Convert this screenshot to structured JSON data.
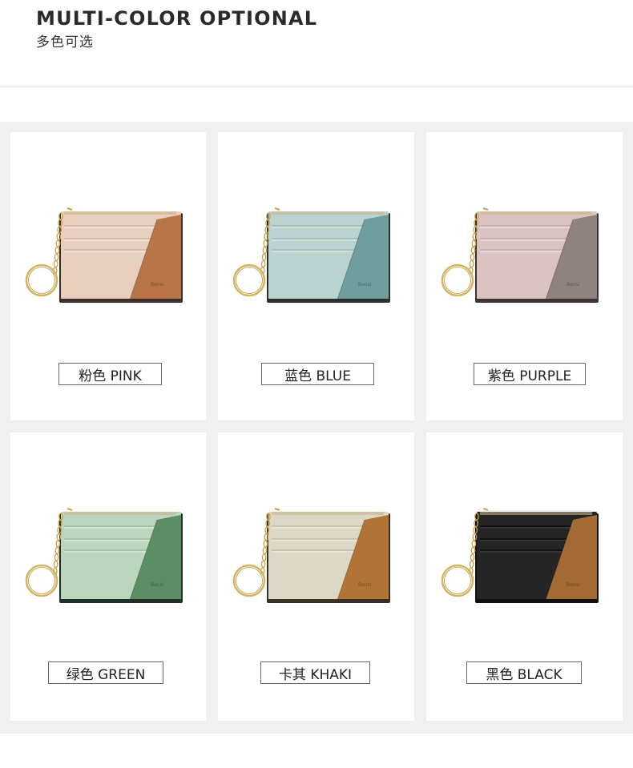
{
  "header": {
    "title": "MULTI-COLOR OPTIONAL",
    "subtitle": "多色可选"
  },
  "products": [
    {
      "label": "粉色 PINK",
      "body_color": "#e9cfbe",
      "accent_color": "#b87548",
      "edge_color": "#3a2e28",
      "brand": "Bensi"
    },
    {
      "label": "蓝色 BLUE",
      "body_color": "#b9d3d0",
      "accent_color": "#6e9f9d",
      "edge_color": "#2a2f30",
      "brand": "Bensi"
    },
    {
      "label": "紫色 PURPLE",
      "body_color": "#dcc3c1",
      "accent_color": "#8f8380",
      "edge_color": "#3a3332",
      "brand": "Bensi"
    },
    {
      "label": "绿色 GREEN",
      "body_color": "#bcd5bd",
      "accent_color": "#5b8e64",
      "edge_color": "#23302a",
      "brand": "Bensi"
    },
    {
      "label": "卡其 KHAKI",
      "body_color": "#dcd8c5",
      "accent_color": "#b27436",
      "edge_color": "#3a3026",
      "brand": "Bensi"
    },
    {
      "label": "黑色 BLACK",
      "body_color": "#252525",
      "accent_color": "#a46a34",
      "edge_color": "#111111",
      "brand": "Bensi"
    }
  ]
}
